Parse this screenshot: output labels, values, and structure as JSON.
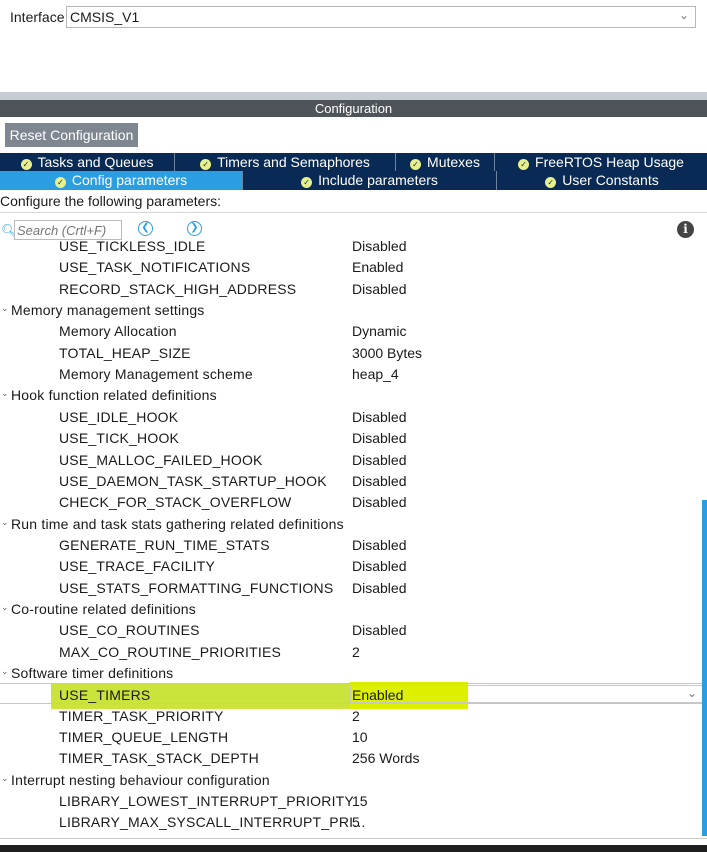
{
  "interface": {
    "label": "Interface",
    "value": "CMSIS_V1"
  },
  "configuration": {
    "title": "Configuration"
  },
  "toolbar": {
    "reset_label": "Reset Configuration"
  },
  "tabs_row1": [
    {
      "label": "Tasks and Queues"
    },
    {
      "label": "Timers and Semaphores"
    },
    {
      "label": "Mutexes"
    },
    {
      "label": "FreeRTOS Heap Usage"
    }
  ],
  "tabs_row2": [
    {
      "label": "Config parameters",
      "active": true
    },
    {
      "label": "Include parameters"
    },
    {
      "label": "User Constants"
    }
  ],
  "hint": "Configure the following parameters:",
  "search": {
    "placeholder": "Search (Crtl+F)"
  },
  "rows": [
    {
      "name": "USE_TICKLESS_IDLE",
      "value": "Disabled"
    },
    {
      "name": "USE_TASK_NOTIFICATIONS",
      "value": "Enabled"
    },
    {
      "name": "RECORD_STACK_HIGH_ADDRESS",
      "value": "Disabled"
    },
    {
      "name": "Memory management settings",
      "group": true
    },
    {
      "name": "Memory Allocation",
      "value": "Dynamic"
    },
    {
      "name": "TOTAL_HEAP_SIZE",
      "value": "3000 Bytes"
    },
    {
      "name": "Memory Management scheme",
      "value": "heap_4"
    },
    {
      "name": "Hook function related definitions",
      "group": true
    },
    {
      "name": "USE_IDLE_HOOK",
      "value": "Disabled"
    },
    {
      "name": "USE_TICK_HOOK",
      "value": "Disabled"
    },
    {
      "name": "USE_MALLOC_FAILED_HOOK",
      "value": "Disabled"
    },
    {
      "name": "USE_DAEMON_TASK_STARTUP_HOOK",
      "value": "Disabled"
    },
    {
      "name": "CHECK_FOR_STACK_OVERFLOW",
      "value": "Disabled"
    },
    {
      "name": "Run time and task stats gathering related definitions",
      "group": true
    },
    {
      "name": "GENERATE_RUN_TIME_STATS",
      "value": "Disabled"
    },
    {
      "name": "USE_TRACE_FACILITY",
      "value": "Disabled"
    },
    {
      "name": "USE_STATS_FORMATTING_FUNCTIONS",
      "value": "Disabled"
    },
    {
      "name": "Co-routine related definitions",
      "group": true
    },
    {
      "name": "USE_CO_ROUTINES",
      "value": "Disabled"
    },
    {
      "name": "MAX_CO_ROUTINE_PRIORITIES",
      "value": "2"
    },
    {
      "name": "Software timer definitions",
      "group": true
    },
    {
      "name": "USE_TIMERS",
      "value": "Enabled",
      "selected": true
    },
    {
      "name": "TIMER_TASK_PRIORITY",
      "value": "2"
    },
    {
      "name": "TIMER_QUEUE_LENGTH",
      "value": "10"
    },
    {
      "name": "TIMER_TASK_STACK_DEPTH",
      "value": "256 Words"
    },
    {
      "name": "Interrupt nesting behaviour configuration",
      "group": true
    },
    {
      "name": "LIBRARY_LOWEST_INTERRUPT_PRIORITY",
      "value": "15"
    },
    {
      "name": "LIBRARY_MAX_SYSCALL_INTERRUPT_PRI...",
      "value": "5"
    }
  ],
  "colors": {
    "tab_bar": "#082a54",
    "tab_active": "#2a9ee0",
    "highlight": "#c8e12a",
    "selection": "#dbe8f6"
  }
}
